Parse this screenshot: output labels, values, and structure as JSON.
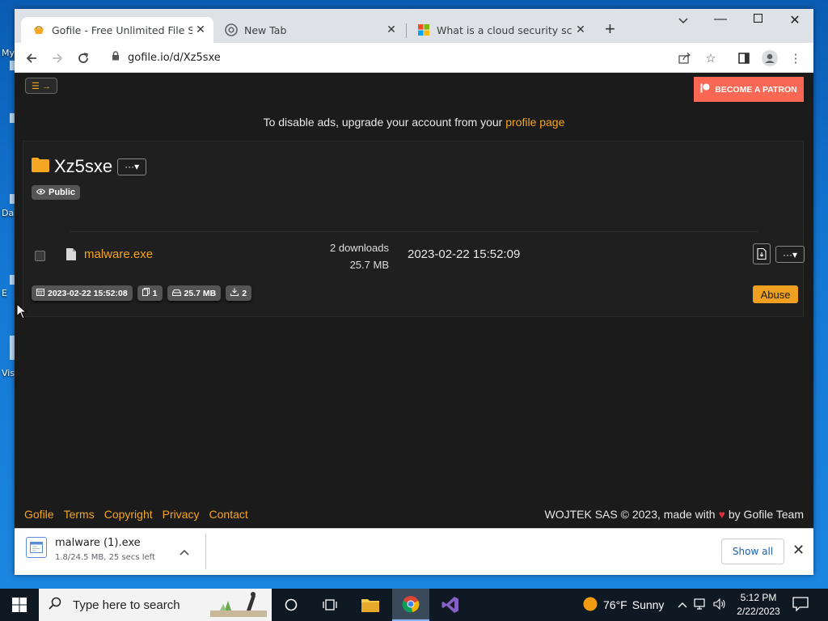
{
  "desktop": {
    "icons": [
      {
        "label": "My"
      },
      {
        "label": "Da"
      },
      {
        "label": "E"
      },
      {
        "label": "Vis"
      }
    ]
  },
  "browser": {
    "tabs": [
      {
        "title": "Gofile - Free Unlimited File Shari",
        "active": true
      },
      {
        "title": "New Tab",
        "active": false
      },
      {
        "title": "What is a cloud security scan? -",
        "active": false
      }
    ],
    "url": "gofile.io/d/Xz5sxe"
  },
  "page": {
    "patron_label": "BECOME A PATRON",
    "ads_text": "To disable ads, upgrade your account from your ",
    "ads_link": "profile page",
    "folder": {
      "name": "Xz5sxe",
      "visibility": "Public"
    },
    "file": {
      "name": "malware.exe",
      "downloads": "2 downloads",
      "size": "25.7 MB",
      "date": "2023-02-22 15:52:09"
    },
    "stats": {
      "created": "2023-02-22 15:52:08",
      "file_count": "1",
      "total_size": "25.7 MB",
      "download_count": "2"
    },
    "abuse_label": "Abuse",
    "footer": {
      "links": [
        "Gofile",
        "Terms",
        "Copyright",
        "Privacy",
        "Contact"
      ],
      "copyright_prefix": "WOJTEK SAS © 2023, made with",
      "copyright_suffix": "by Gofile Team"
    }
  },
  "download_bar": {
    "filename": "malware (1).exe",
    "progress": "1.8/24.5 MB, 25 secs left",
    "show_all": "Show all"
  },
  "taskbar": {
    "search_placeholder": "Type here to search",
    "weather_temp": "76°F",
    "weather_desc": "Sunny",
    "time": "5:12 PM",
    "date": "2/22/2023"
  },
  "colors": {
    "accent": "#f5a623",
    "patron": "#f96854",
    "page_bg": "#1b1b1b",
    "abuse": "#f0a020"
  }
}
